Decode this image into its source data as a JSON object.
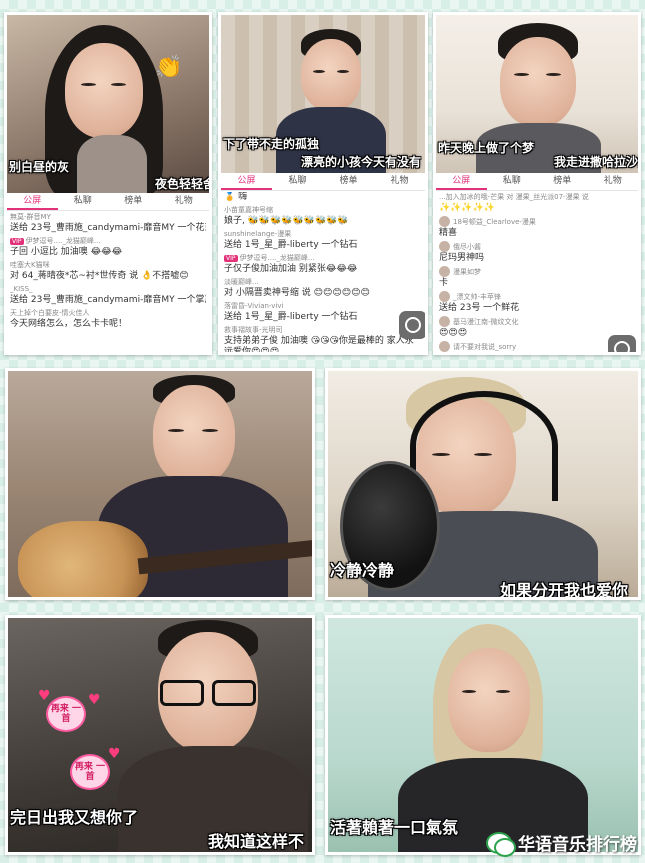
{
  "tiles": {
    "t1": {
      "captions": [
        "别白昼的灰",
        "夜色轻轻舍"
      ],
      "tabs": [
        "公屏",
        "私聊",
        "榜单",
        "礼物"
      ],
      "chat": [
        {
          "who": "無莫-群音MY",
          "text": "送给 23号_曹雨施_candymami-靡音MY 一个花束"
        },
        {
          "who": "伊梦逗号...._龙猫巅峰...",
          "text": "子回 小逗比 加油噢 😂😂😂",
          "vip": "VIP"
        },
        {
          "who": "哇塞大K猫咪",
          "text": "对 64_蒋晴夜*芯~衬*世传奇 说 👌不搭嘘😊"
        },
        {
          "who": "_KISS_",
          "text": "送给 23号_曹雨施_candymami-靡音MY 一个掌声"
        },
        {
          "who": "天上掉个白要皮-情火佳人",
          "text": "今天网络怎么，怎么卡卡呢！"
        }
      ]
    },
    "t2": {
      "captions": [
        "下了带不走的孤独",
        "漂亮的小孩今天有没有"
      ],
      "tabs": [
        "公屏",
        "私聊",
        "榜单",
        "礼物"
      ],
      "chat": [
        {
          "who": "",
          "text": "🏅 嗨"
        },
        {
          "who": "小苗童嘉神号缩",
          "text": "娘子, 🐝🐝🐝🐝🐝🐝🐝🐝🐝"
        },
        {
          "who": "sunshinelange-漫果",
          "text": "送给 1号_星_爵-liberty 一个钻石"
        },
        {
          "who": "伊梦逗号...._龙猫巅峰...",
          "text": "子仅子俊加油加油 别紧张😂😂😂",
          "vip": "VIP"
        },
        {
          "who": "淡暖巅峰...",
          "text": "对 小隔晋卖神号缩 说 😊😊😊😊😊😊"
        },
        {
          "who": "落雷昏-Vivian-vivi",
          "text": "送给 1号_星_爵-liberty 一个钻石"
        },
        {
          "who": "救事褶故事-光明司",
          "text": "支持弟弟子俊 加油噢 😘😘😘你是最棒的 家人永远爱你😍😍😍"
        }
      ]
    },
    "t3": {
      "captions": [
        "昨天晚上做了个梦",
        "我走进撒哈拉沙漠"
      ],
      "tabs": [
        "公屏",
        "私聊",
        "榜单",
        "礼物"
      ],
      "chat": [
        {
          "who": "...加入加冰的哦-芒果 对 漫果_丝光派07-漫果 说",
          "text": "✨✨✨✨✨"
        },
        {
          "who": "18号顿益_Clearlove-漫果",
          "text": "精喜"
        },
        {
          "who": "俄尽小酱",
          "text": "尼玛男神吗"
        },
        {
          "who": "漫果如梦",
          "text": "卡"
        },
        {
          "who": "_漂文帅-丰苹锋",
          "text": "送给 23号 一个鲜花"
        },
        {
          "who": "基马漫江南-微纹文化",
          "text": "😍😍😍"
        },
        {
          "who": "请不要对我说_sorry",
          "text": "哇塞"
        }
      ]
    },
    "t4": {
      "captions": []
    },
    "t5": {
      "captions": [
        "冷静冷静",
        "如果分开我也爱你"
      ]
    },
    "t6": {
      "captions": [
        "完日出我又想你了",
        "我知道这样不"
      ],
      "stickers": [
        "再来 一首",
        "再来 一首"
      ]
    },
    "t7": {
      "captions": [
        "活著賴著一口氣氛"
      ]
    }
  },
  "watermark": {
    "text": "华语音乐排行榜"
  },
  "colors": {
    "accent": "#e2327a",
    "brand": "#2ca24c"
  }
}
